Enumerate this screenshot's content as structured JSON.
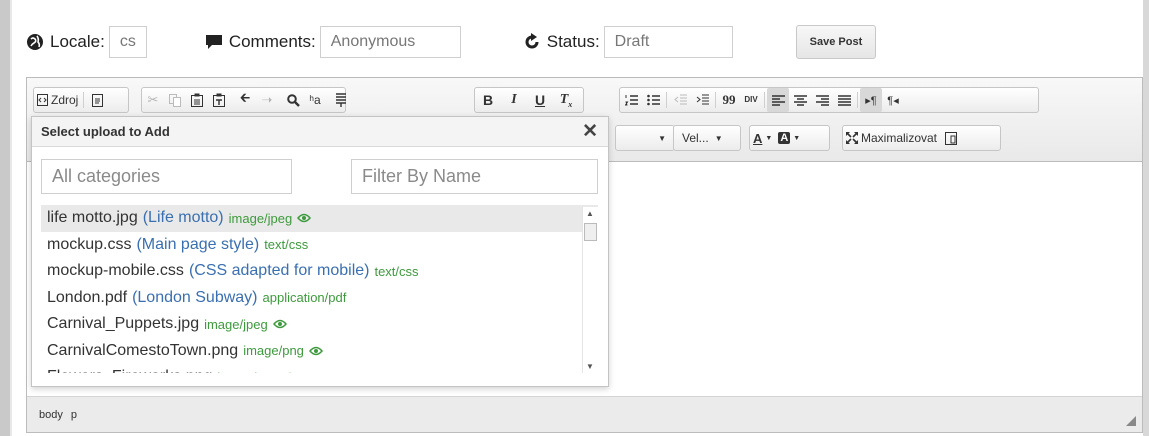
{
  "top": {
    "locale_label": "Locale:",
    "locale_value": "cs",
    "comments_label": "Comments:",
    "comments_value": "Anonymous",
    "status_label": "Status:",
    "status_value": "Draft",
    "save_label": "Save Post"
  },
  "toolbar": {
    "source_label": "Zdroj",
    "size_combo": "Vel...",
    "maximize_label": "Maximalizovat",
    "bold": "B",
    "italic": "I",
    "underline": "U",
    "text_color": "A",
    "bg_color": "A",
    "blockquote": "99",
    "div": "DIV",
    "ltr": "¶",
    "rtl": "¶"
  },
  "popup": {
    "title": "Select upload to Add",
    "close": "✕",
    "categories_placeholder": "All categories",
    "filter_placeholder": "Filter By Name",
    "items": [
      {
        "name": "life motto.jpg",
        "title": "(Life motto)",
        "mime": "image/jpeg",
        "preview": true
      },
      {
        "name": "mockup.css",
        "title": "(Main page style)",
        "mime": "text/css",
        "preview": false
      },
      {
        "name": "mockup-mobile.css",
        "title": "(CSS adapted for mobile)",
        "mime": "text/css",
        "preview": false
      },
      {
        "name": "London.pdf",
        "title": "(London Subway)",
        "mime": "application/pdf",
        "preview": false
      },
      {
        "name": "Carnival_Puppets.jpg",
        "title": "",
        "mime": "image/jpeg",
        "preview": true
      },
      {
        "name": "CarnivalComestoTown.png",
        "title": "",
        "mime": "image/png",
        "preview": true
      },
      {
        "name": "Flowers_Fireworks.png",
        "title": "",
        "mime": "image/png",
        "preview": true
      }
    ]
  },
  "statusbar": {
    "path": [
      "body",
      "p"
    ]
  },
  "colors": {
    "title_blue": "#3a6fb0",
    "mime_green": "#3d9a3d",
    "selected_row": "#e9e9e9"
  }
}
